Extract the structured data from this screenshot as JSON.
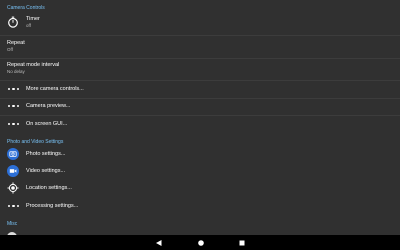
{
  "sections": {
    "camera_controls": "Camera Controls",
    "photo_video": "Photo and Video Settings",
    "misc": "Misc"
  },
  "items": {
    "timer": {
      "title": "Timer",
      "summary": "off",
      "icon": "timer-icon"
    },
    "repeat": {
      "title": "Repeat",
      "summary": "Off"
    },
    "repeat_interval": {
      "title": "Repeat mode interval",
      "summary": "No delay"
    },
    "more_camera": {
      "title": "More camera controls...",
      "icon": "more-dots-icon"
    },
    "camera_preview": {
      "title": "Camera preview...",
      "icon": "more-dots-icon"
    },
    "onscreen_gui": {
      "title": "On screen GUI...",
      "icon": "more-dots-icon"
    },
    "photo_settings": {
      "title": "Photo settings...",
      "icon": "camera-icon"
    },
    "video_settings": {
      "title": "Video settings...",
      "icon": "video-icon"
    },
    "location_settings": {
      "title": "Location settings...",
      "icon": "gps-icon"
    },
    "processing_settings": {
      "title": "Processing settings...",
      "icon": "more-dots-icon"
    }
  },
  "navbar": {
    "back": "back-icon",
    "home": "home-icon",
    "recents": "recents-icon"
  },
  "colors": {
    "background": "#303030",
    "accent": "#79c2f5",
    "icon_blue": "#2c6fd6",
    "navbar": "#000000"
  }
}
